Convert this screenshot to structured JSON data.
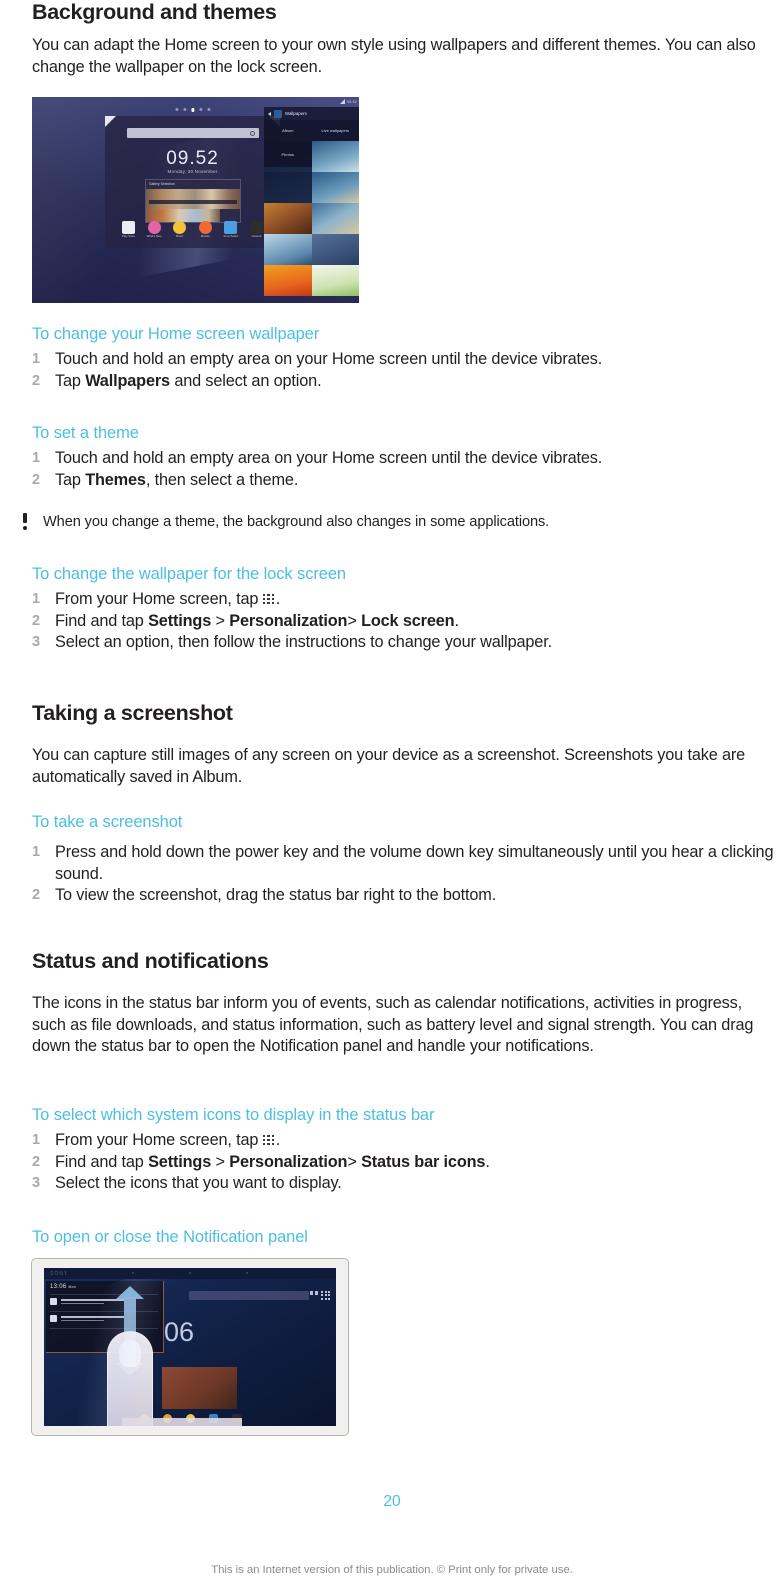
{
  "document": {
    "page_number": "20",
    "footer": "This is an Internet version of this publication. © Print only for private use.",
    "accent_color": "#4cbfe1",
    "text_color": "#231f20",
    "step_number_color": "#a7a9ac"
  },
  "sections": [
    {
      "id": "background-and-themes",
      "title": "Background and themes",
      "intro": "You can adapt the Home screen to your own style using wallpapers and different themes. You can also change the wallpaper on the lock screen.",
      "figure": {
        "name": "home-screen-wallpapers-figure",
        "device": {
          "clock": "09.52",
          "date": "Monday, 30 November",
          "search_placeholder": "Search",
          "widget_title": "Gallery Selection",
          "dock_apps": [
            {
              "label": "Play Store",
              "color": "#e8eef4"
            },
            {
              "label": "What's New",
              "color": "#e563a8"
            },
            {
              "label": "Music",
              "color": "#f5c03a"
            },
            {
              "label": "Movies",
              "color": "#ef6a34"
            },
            {
              "label": "Sony Select",
              "color": "#4a9fe0"
            },
            {
              "label": "Camera",
              "color": "#2d2d2d"
            }
          ]
        },
        "wallpaper_panel": {
          "title": "Wallpapers",
          "status_text": "09.52",
          "tabs": [
            "Album",
            "Live wallpapers"
          ],
          "secondary": "Photos",
          "thumbnails": [
            "#1b2b4a",
            "#2e5c86",
            "#8a5a33",
            "#3c6f9c",
            "#a7c9dd",
            "#5d89ad",
            "#e8851f",
            "#cfe3b4"
          ]
        }
      },
      "procedures": [
        {
          "heading": "To change your Home screen wallpaper",
          "steps": [
            [
              {
                "t": "Touch and hold an empty area on your Home screen until the device vibrates.",
                "b": false
              }
            ],
            [
              {
                "t": "Tap ",
                "b": false
              },
              {
                "t": "Wallpapers",
                "b": true
              },
              {
                "t": " and select an option.",
                "b": false
              }
            ]
          ]
        },
        {
          "heading": "To set a theme",
          "steps": [
            [
              {
                "t": "Touch and hold an empty area on your Home screen until the device vibrates.",
                "b": false
              }
            ],
            [
              {
                "t": "Tap ",
                "b": false
              },
              {
                "t": "Themes",
                "b": true
              },
              {
                "t": ", then select a theme.",
                "b": false
              }
            ]
          ],
          "note": "When you change a theme, the background also changes in some applications."
        },
        {
          "heading": "To change the wallpaper for the lock screen",
          "steps": [
            [
              {
                "t": "From your Home screen, tap ",
                "b": false
              },
              {
                "icon": "app-drawer-grid-icon"
              },
              {
                "t": ".",
                "b": false
              }
            ],
            [
              {
                "t": "Find and tap ",
                "b": false
              },
              {
                "t": "Settings",
                "b": true
              },
              {
                "t": " > ",
                "b": false
              },
              {
                "t": "Personalization",
                "b": true
              },
              {
                "t": "> ",
                "b": false
              },
              {
                "t": "Lock screen",
                "b": true
              },
              {
                "t": ".",
                "b": false
              }
            ],
            [
              {
                "t": "Select an option, then follow the instructions to change your wallpaper.",
                "b": false
              }
            ]
          ]
        }
      ]
    },
    {
      "id": "taking-a-screenshot",
      "title": "Taking a screenshot",
      "intro": "You can capture still images of any screen on your device as a screenshot. Screenshots you take are automatically saved in Album.",
      "procedures": [
        {
          "heading": "To take a screenshot",
          "steps": [
            [
              {
                "t": "Press and hold down the power key and the volume down key simultaneously until you hear a clicking sound.",
                "b": false
              }
            ],
            [
              {
                "t": "To view the screenshot, drag the status bar right to the bottom.",
                "b": false
              }
            ]
          ]
        }
      ]
    },
    {
      "id": "status-and-notifications",
      "title": "Status and notifications",
      "intro": "The icons in the status bar inform you of events, such as calendar notifications, activities in progress, such as file downloads, and status information, such as battery level and signal strength. You can drag down the status bar to open the Notification panel and handle your notifications.",
      "procedures": [
        {
          "heading": "To select which system icons to display in the status bar",
          "steps": [
            [
              {
                "t": "From your Home screen, tap ",
                "b": false
              },
              {
                "icon": "app-drawer-grid-icon"
              },
              {
                "t": ".",
                "b": false
              }
            ],
            [
              {
                "t": "Find and tap ",
                "b": false
              },
              {
                "t": "Settings",
                "b": true
              },
              {
                "t": " > ",
                "b": false
              },
              {
                "t": "Personalization",
                "b": true
              },
              {
                "t": "> ",
                "b": false
              },
              {
                "t": "Status bar icons",
                "b": true
              },
              {
                "t": ".",
                "b": false
              }
            ],
            [
              {
                "t": "Select the icons that you want to display.",
                "b": false
              }
            ]
          ]
        },
        {
          "heading": "To open or close the Notification panel",
          "figure": {
            "name": "notification-panel-drag-figure",
            "brand": "SONY",
            "clock": "06",
            "notification_title": "13:06",
            "notification_title_sub": "Mon"
          }
        }
      ]
    }
  ]
}
